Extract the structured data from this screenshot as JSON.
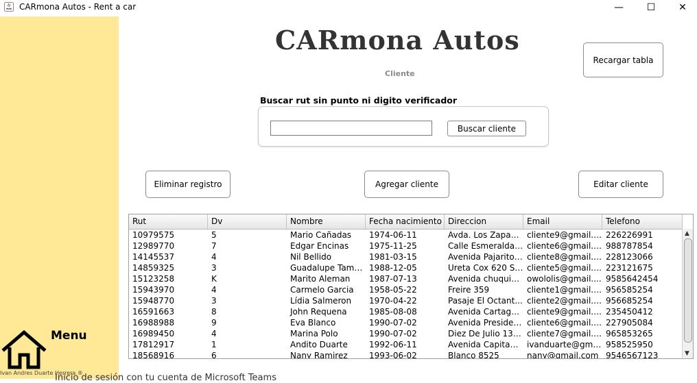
{
  "window": {
    "title": "CARmona Autos - Rent a car",
    "minimize_glyph": "—",
    "maximize_glyph": "☐",
    "close_glyph": "✕"
  },
  "sidebar": {
    "menu_label": "Menu",
    "menu_icon": "home-icon",
    "credit": "Ivan Andres Duarte Herrera ®"
  },
  "background_text": "Inicio de sesión con tu cuenta de Microsoft Teams",
  "header": {
    "brand": "CARmona Autos",
    "subtitle": "Cliente"
  },
  "toolbar": {
    "reload_label": "Recargar tabla",
    "delete_label": "Eliminar registro",
    "add_label": "Agregar cliente",
    "edit_label": "Editar cliente"
  },
  "search": {
    "label": "Buscar rut sin punto ni digito verificador",
    "value": "",
    "button_label": "Buscar cliente"
  },
  "table": {
    "columns": [
      "Rut",
      "Dv",
      "Nombre",
      "Fecha nacimiento",
      "Direccion",
      "Email",
      "Telefono"
    ],
    "rows": [
      [
        "10979575",
        "5",
        "Mario Cañadas",
        "1974-06-11",
        " Avda. Los Zapad...",
        "cliente9@gmail.c...",
        "226226991"
      ],
      [
        "12989770",
        "7",
        "Edgar Encinas",
        "1975-11-25",
        "Calle Esmeralda,...",
        "cliente6@gmail.c...",
        "988787854"
      ],
      [
        "14145537",
        "4",
        "Nil Bellido",
        "1981-03-15",
        "Avenida Pajaritos...",
        "cliente8@gmail.c...",
        "228123066"
      ],
      [
        "14859325",
        "3",
        "Guadalupe Tama...",
        "1988-12-05",
        "Ureta Cox 620 Sa...",
        "cliente5@gmail.c...",
        "223121675"
      ],
      [
        "15123258",
        "K",
        "Marito Aleman",
        "1987-07-13",
        "Avenida chuquip...",
        "owololis@gmail....",
        "9585642454"
      ],
      [
        "15943970",
        "4",
        "Carmelo Garcia",
        "1958-05-22",
        "Freire 359",
        "cliente1@gmail.c...",
        "956585254"
      ],
      [
        "15948770",
        "3",
        "Lídia Salmeron",
        "1970-04-22",
        "Pasaje El Octant...",
        "cliente2@gmail.c...",
        "956685254"
      ],
      [
        "16591663",
        "8",
        "John Requena",
        "1985-08-08",
        "Avenida Cartage...",
        "cliente9@gmail.c...",
        "235450412"
      ],
      [
        "16988988",
        "9",
        "Eva Blanco",
        "1990-07-02",
        "Avenida Presiden...",
        "cliente6@gmail.c...",
        "227905084"
      ],
      [
        "16989450",
        "4",
        "Marina Polo",
        "1990-07-02",
        "Diez De Julio 139...",
        "cliente7@gmail.c...",
        "965853265"
      ],
      [
        "17812917",
        "1",
        "Andito Duarte",
        "1992-06-11",
        "Avenida Capitan ...",
        "ivanduarte@gmai...",
        "958525950"
      ],
      [
        "18568916",
        "6",
        "Nany Ramirez",
        "1993-06-02",
        "Blanco 8525",
        "nany@gmail.com",
        "9546567123"
      ]
    ]
  },
  "colors": {
    "sidebar": "#ffe896",
    "brand_text": "#333333",
    "subtitle_text": "#8a8a8a"
  }
}
